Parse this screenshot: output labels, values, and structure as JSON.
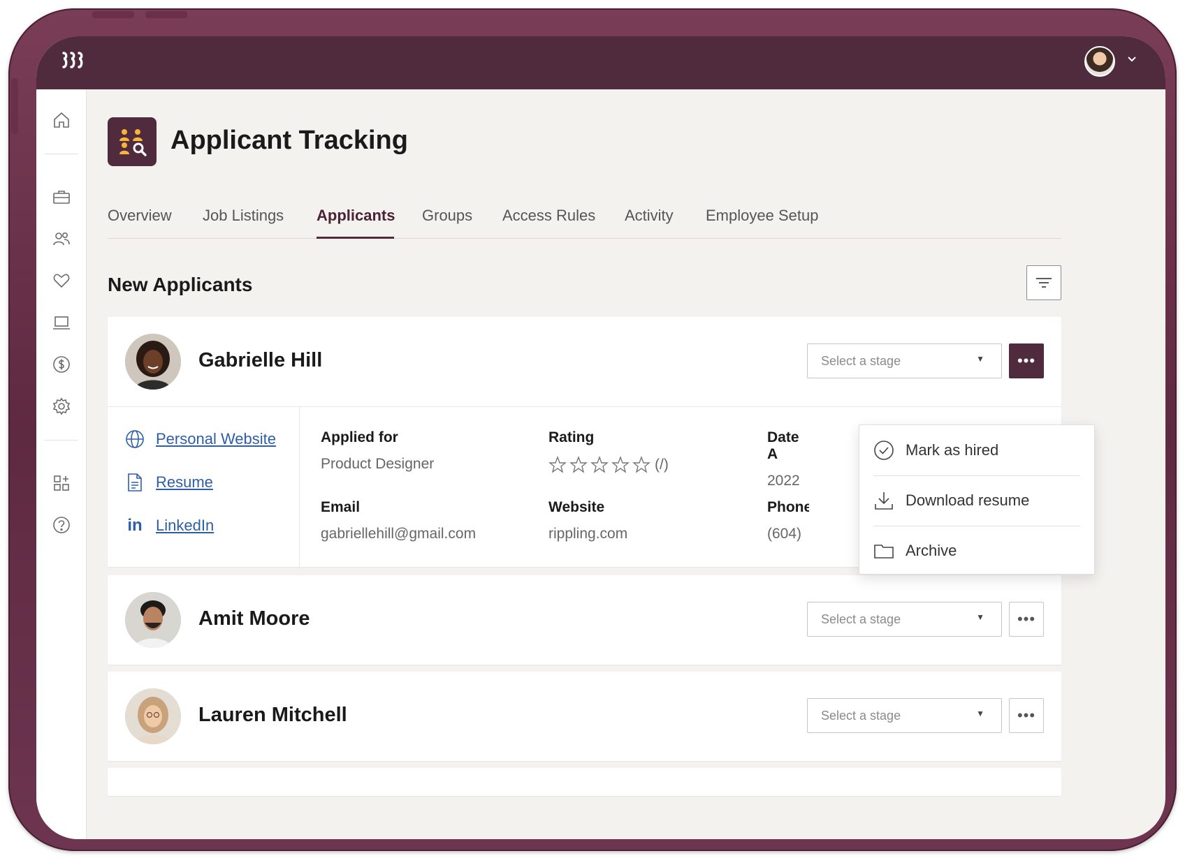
{
  "app": {
    "logo_text": "𝖗𝖗𝖗",
    "page_title": "Applicant Tracking"
  },
  "tabs": [
    {
      "label": "Overview"
    },
    {
      "label": "Job Listings"
    },
    {
      "label": "Applicants",
      "active": true
    },
    {
      "label": "Groups"
    },
    {
      "label": "Access Rules"
    },
    {
      "label": "Activity"
    },
    {
      "label": "Employee Setup"
    }
  ],
  "section_title": "New Applicants",
  "stage_placeholder": "Select a stage",
  "applicants": [
    {
      "name": "Gabrielle Hill",
      "expanded": true,
      "links": [
        {
          "label": "Personal Website",
          "icon": "globe-icon"
        },
        {
          "label": "Resume",
          "icon": "document-icon"
        },
        {
          "label": "LinkedIn",
          "icon": "linkedin-icon"
        }
      ],
      "applied_for_label": "Applied for",
      "applied_for": "Product Designer",
      "rating_label": "Rating",
      "rating_text": "(/)",
      "date_label": "Date A",
      "date_value": "2022",
      "email_label": "Email",
      "email": "gabriellehill@gmail.com",
      "website_label": "Website",
      "website": "rippling.com",
      "phone_label": "Phone",
      "phone": "(604)"
    },
    {
      "name": "Amit Moore"
    },
    {
      "name": "Lauren Mitchell"
    }
  ],
  "menu": {
    "items": [
      {
        "label": "Mark as hired",
        "icon": "check-circle-icon"
      },
      {
        "label": "Download resume",
        "icon": "download-icon"
      },
      {
        "label": "Archive",
        "icon": "folder-icon"
      }
    ]
  },
  "colors": {
    "brand": "#502a3d",
    "link": "#2e5ea8",
    "background": "#f4f2ef"
  }
}
